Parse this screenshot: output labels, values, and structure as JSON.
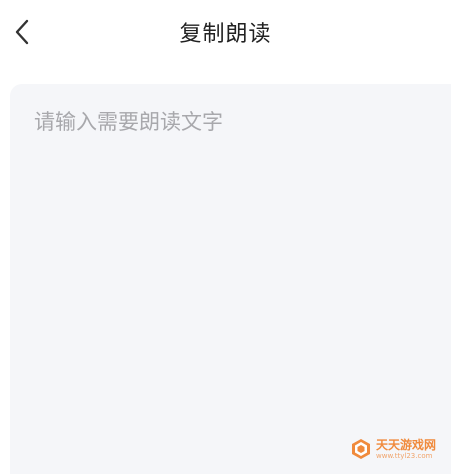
{
  "header": {
    "title": "复制朗读"
  },
  "editor": {
    "placeholder": "请输入需要朗读文字",
    "value": ""
  },
  "watermark": {
    "brand": "天天游戏网",
    "site": "www.ttyl23.com"
  },
  "colors": {
    "panel_background": "#f5f6f9",
    "title_text": "#222222",
    "placeholder_text": "#a8a8ac",
    "watermark_orange": "#f08a3c"
  },
  "icons": {
    "back": "chevron-left-icon",
    "watermark_logo": "cube-logo-icon"
  }
}
